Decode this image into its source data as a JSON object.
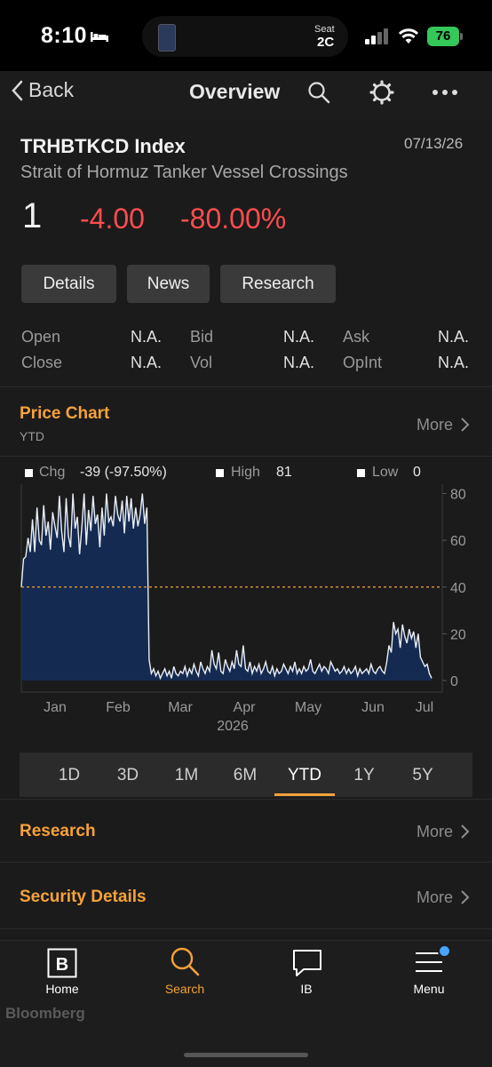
{
  "status_bar": {
    "time": "8:10",
    "seat_label": "Seat",
    "seat_value": "2C",
    "battery": "76"
  },
  "nav": {
    "back_label": "Back",
    "title": "Overview",
    "icons": [
      "search-icon",
      "gear-icon",
      "more-icon"
    ]
  },
  "security": {
    "ticker": "TRHBTKCD Index",
    "date": "07/13/26",
    "description": "Strait of Hormuz Tanker Vessel Crossings",
    "last": "1",
    "change": "-4.00",
    "change_pct": "-80.00%",
    "down_color": "#ff4d4d"
  },
  "tabs": [
    "Details",
    "News",
    "Research"
  ],
  "quote": {
    "open_label": "Open",
    "open": "N.A.",
    "close_label": "Close",
    "close": "N.A.",
    "bid_label": "Bid",
    "bid": "N.A.",
    "vol_label": "Vol",
    "vol": "N.A.",
    "ask_label": "Ask",
    "ask": "N.A.",
    "opint_label": "OpInt",
    "opint": "N.A."
  },
  "price_chart": {
    "title": "Price Chart",
    "subtitle": "YTD",
    "more": "More",
    "accent": "#f5a23a",
    "legend": {
      "chg_label": "Chg",
      "chg_value": "-39 (-97.50%)",
      "high_label": "High",
      "high_value": "81",
      "low_label": "Low",
      "low_value": "0"
    }
  },
  "chart_data": {
    "type": "area",
    "x_ticks": [
      "Jan",
      "Feb",
      "Mar",
      "Apr",
      "May",
      "Jun",
      "Jul"
    ],
    "x_year": "2026",
    "y_ticks": [
      "80",
      "60",
      "40",
      "20",
      "0"
    ],
    "ylim": [
      0,
      84
    ],
    "reference_line": 40,
    "fill_color": "#152a50",
    "line_color": "#e8eef8",
    "series": [
      {
        "values": [
          40,
          52,
          53,
          61,
          55,
          69,
          55,
          74,
          60,
          58,
          75,
          62,
          68,
          56,
          72,
          66,
          61,
          79,
          64,
          55,
          78,
          62,
          57,
          80,
          65,
          70,
          54,
          66,
          80,
          58,
          73,
          64,
          79,
          67,
          71,
          57,
          74,
          62,
          80,
          68,
          70,
          66,
          79,
          71,
          68,
          77,
          63,
          79,
          68,
          78,
          65,
          74,
          66,
          71,
          80,
          67,
          74,
          9,
          3,
          5,
          2,
          4,
          1,
          3,
          5,
          2,
          4,
          1,
          6,
          3,
          2,
          4,
          3,
          6,
          2,
          5,
          3,
          7,
          4,
          2,
          8,
          5,
          3,
          6,
          4,
          13,
          7,
          5,
          12,
          4,
          3,
          9,
          6,
          4,
          8,
          5,
          13,
          7,
          6,
          15,
          5,
          4,
          8,
          3,
          6,
          4,
          7,
          3,
          5,
          8,
          4,
          3,
          6,
          2,
          5,
          3,
          4,
          7,
          5,
          3,
          6,
          4,
          8,
          3,
          5,
          3,
          6,
          4,
          5,
          9,
          4,
          3,
          5,
          7,
          4,
          6,
          5,
          3,
          8,
          6,
          4,
          5,
          3,
          4,
          6,
          3,
          5,
          3,
          4,
          6,
          2,
          5,
          3,
          4,
          5,
          3,
          7,
          4,
          3,
          5,
          6,
          4,
          3,
          8,
          15,
          12,
          25,
          20,
          22,
          14,
          24,
          19,
          16,
          22,
          18,
          21,
          14,
          20,
          10,
          8,
          6,
          7,
          3,
          1
        ]
      }
    ]
  },
  "ranges": [
    "1D",
    "3D",
    "1M",
    "6M",
    "YTD",
    "1Y",
    "5Y"
  ],
  "selected_range": "YTD",
  "sections": {
    "research_title": "Research",
    "research_more": "More",
    "details_title": "Security Details",
    "details_more": "More"
  },
  "tab_bar": {
    "home": "Home",
    "search": "Search",
    "ib": "IB",
    "menu": "Menu",
    "watermark": "Bloomberg",
    "active_color": "#f5a23a",
    "badge_color": "#4aa3ff"
  }
}
